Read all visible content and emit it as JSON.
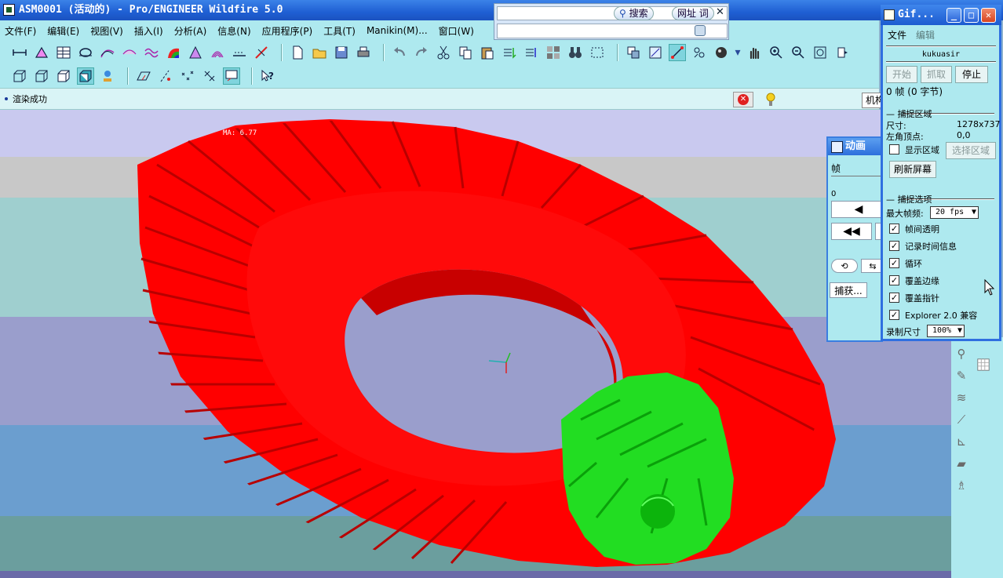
{
  "window": {
    "title": "ASM0001 (活动的) - Pro/ENGINEER Wildfire 5.0"
  },
  "menu": [
    "文件(F)",
    "编辑(E)",
    "视图(V)",
    "插入(I)",
    "分析(A)",
    "信息(N)",
    "应用程序(P)",
    "工具(T)",
    "Manikin(M)...",
    "窗口(W)"
  ],
  "status": {
    "message": "渲染成功",
    "filter_value": "机构"
  },
  "search": {
    "search_label": "搜索",
    "url_label": "网址 词"
  },
  "viewport": {
    "annotation": "MA: 6.77",
    "gear_color": "#ff0000",
    "pinion_color": "#22dd22"
  },
  "anim_dialog": {
    "title": "动画",
    "frame_label": "帧",
    "zero_label": "0",
    "capture_label": "捕获..."
  },
  "gif_recorder": {
    "title": "Gif...",
    "menu_file": "文件",
    "menu_edit": "编辑",
    "user": "kukuasir",
    "btn_start": "开始",
    "btn_grab": "抓取",
    "btn_stop": "停止",
    "frames": "0 帧 (0 字节)",
    "capture_area": "捕捉区域",
    "size_label": "尺寸:",
    "size_value": "1278x737",
    "corner_label": "左角顶点:",
    "corner_value": "0,0",
    "show_area": "显示区域",
    "select_area": "选择区域",
    "refresh": "刷新屏幕",
    "capture_options": "捕捉选项",
    "max_fps_label": "最大帧频:",
    "max_fps": "20 fps",
    "options": [
      {
        "label": "帧间透明",
        "checked": true
      },
      {
        "label": "记录时间信息",
        "checked": true
      },
      {
        "label": "循环",
        "checked": true
      },
      {
        "label": "覆盖边缘",
        "checked": true
      },
      {
        "label": "覆盖指针",
        "checked": true
      },
      {
        "label": "Explorer 2.0 兼容",
        "checked": true
      }
    ],
    "record_size_label": "录制尺寸",
    "record_size": "100%"
  }
}
